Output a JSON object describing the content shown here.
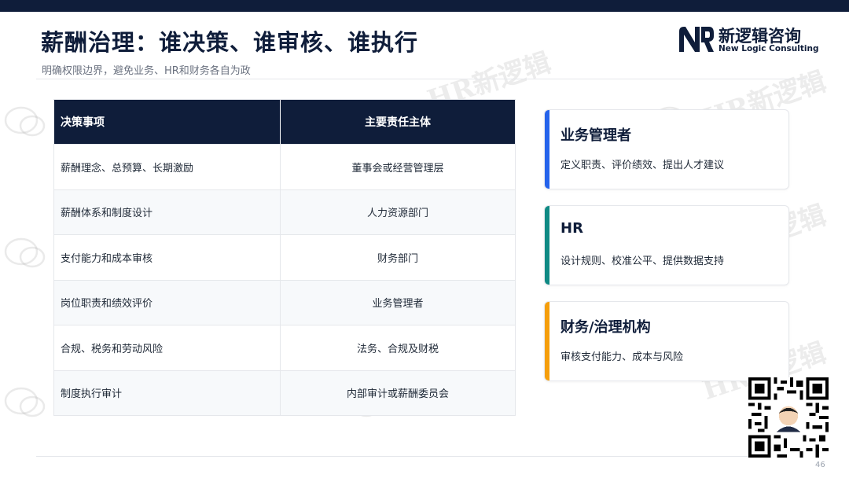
{
  "title": "薪酬治理：谁决策、谁审核、谁执行",
  "subtitle": "明确权限边界，避免业务、HR和财务各自为政",
  "logo": {
    "name_cn": "新逻辑咨询",
    "name_en": "New Logic Consulting",
    "mark_icon": "nl-logo-icon"
  },
  "watermark_text": "HR新逻辑",
  "table": {
    "headers": [
      "决策事项",
      "主要责任主体"
    ],
    "rows": [
      [
        "薪酬理念、总预算、长期激励",
        "董事会或经营管理层"
      ],
      [
        "薪酬体系和制度设计",
        "人力资源部门"
      ],
      [
        "支付能力和成本审核",
        "财务部门"
      ],
      [
        "岗位职责和绩效评价",
        "业务管理者"
      ],
      [
        "合规、税务和劳动风险",
        "法务、合规及财税"
      ],
      [
        "制度执行审计",
        "内部审计或薪酬委员会"
      ]
    ]
  },
  "cards": [
    {
      "title": "业务管理者",
      "text": "定义职责、评价绩效、提出人才建议",
      "accent": "#2563eb"
    },
    {
      "title": "HR",
      "text": "设计规则、校准公平、提供数据支持",
      "accent": "#0f8a84"
    },
    {
      "title": "财务/治理机构",
      "text": "审核支付能力、成本与风险",
      "accent": "#f59e0b"
    }
  ],
  "page_number": "46",
  "colors": {
    "primary": "#0f1d3a",
    "row_alt": "#f7f9fb",
    "border": "#e5e7eb"
  }
}
